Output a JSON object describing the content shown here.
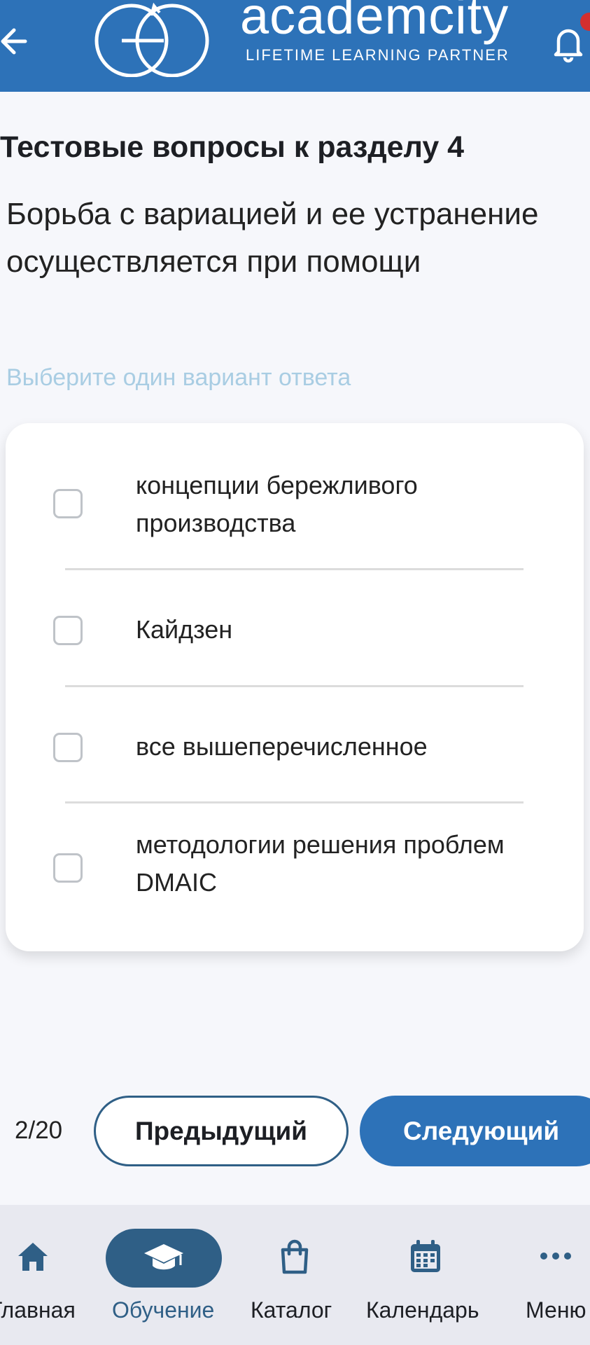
{
  "header": {
    "brand_name": "academcity",
    "brand_tagline": "LIFETIME LEARNING PARTNER",
    "color": "#2d72b8"
  },
  "test": {
    "section_title": "Тестовые вопросы к разделу 4",
    "question": "Борьба с вариацией и ее устранение осуществляется при помощи",
    "hint": "Выберите один вариант ответа",
    "options": [
      {
        "label": "концепции бережливого производства",
        "checked": false
      },
      {
        "label": "Кайдзен",
        "checked": false
      },
      {
        "label": "все вышеперечисленное",
        "checked": false
      },
      {
        "label": "методологии решения проблем DMAIC",
        "checked": false
      }
    ]
  },
  "pagination": {
    "counter": "2/20",
    "prev_label": "Предыдущий",
    "next_label": "Следующий"
  },
  "bottom_nav": {
    "items": [
      {
        "label": "Главная",
        "icon": "home-icon",
        "active": false
      },
      {
        "label": "Обучение",
        "icon": "graduation-cap-icon",
        "active": true
      },
      {
        "label": "Каталог",
        "icon": "shopping-bag-icon",
        "active": false
      },
      {
        "label": "Календарь",
        "icon": "calendar-icon",
        "active": false
      },
      {
        "label": "Меню",
        "icon": "more-dots-icon",
        "active": false
      }
    ],
    "active_color": "#2f5f86"
  }
}
